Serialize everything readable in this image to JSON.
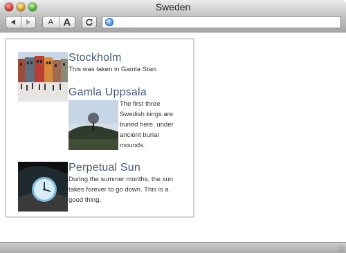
{
  "window": {
    "title": "Sweden"
  },
  "toolbar": {
    "back_icon": "left-triangle-icon",
    "forward_icon": "right-triangle-icon",
    "text_smaller_label": "A",
    "text_larger_label": "A",
    "reload_icon": "reload-icon",
    "address_value": ""
  },
  "page": {
    "sections": [
      {
        "title": "Stockholm",
        "text": "This was taken in Gamla Stan."
      },
      {
        "title": "Gamla Uppsala",
        "text_lines": [
          "The first three",
          "Swedish kings are",
          "buried here, under",
          "ancient burial",
          "mounds."
        ]
      },
      {
        "title": "Perpetual Sun",
        "text_lines": [
          "During the summer months, the sun",
          "takes forever to go down. This is a",
          "good thing."
        ]
      }
    ]
  },
  "colors": {
    "heading": "#445a73",
    "box_border": "#d2d2d2"
  }
}
